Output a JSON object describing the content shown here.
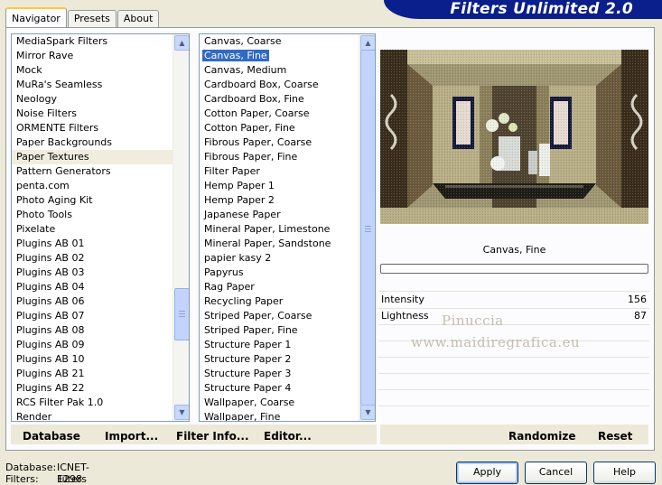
{
  "window": {
    "title": "Filters Unlimited 2.0"
  },
  "tabs": [
    {
      "label": "Navigator"
    },
    {
      "label": "Presets"
    },
    {
      "label": "About"
    }
  ],
  "categories": [
    "MediaSpark Filters",
    "Mirror Rave",
    "Mock",
    "MuRa's Seamless",
    "Neology",
    "Noise Filters",
    "ORMENTE Filters",
    "Paper Backgrounds",
    "Paper Textures",
    "Pattern Generators",
    "penta.com",
    "Photo Aging Kit",
    "Photo Tools",
    "Pixelate",
    "Plugins AB 01",
    "Plugins AB 02",
    "Plugins AB 03",
    "Plugins AB 04",
    "Plugins AB 06",
    "Plugins AB 07",
    "Plugins AB 08",
    "Plugins AB 09",
    "Plugins AB 10",
    "Plugins AB 21",
    "Plugins AB 22",
    "RCS Filter Pak 1.0",
    "Render"
  ],
  "filters": [
    "Canvas, Coarse",
    "Canvas, Fine",
    "Canvas, Medium",
    "Cardboard Box, Coarse",
    "Cardboard Box, Fine",
    "Cotton Paper, Coarse",
    "Cotton Paper, Fine",
    "Fibrous Paper, Coarse",
    "Fibrous Paper, Fine",
    "Filter Paper",
    "Hemp Paper 1",
    "Hemp Paper 2",
    "Japanese Paper",
    "Mineral Paper, Limestone",
    "Mineral Paper, Sandstone",
    "papier kasy 2",
    "Papyrus",
    "Rag Paper",
    "Recycling Paper",
    "Striped Paper, Coarse",
    "Striped Paper, Fine",
    "Structure Paper 1",
    "Structure Paper 2",
    "Structure Paper 3",
    "Structure Paper 4",
    "Wallpaper, Coarse",
    "Wallpaper, Fine"
  ],
  "selected_filter": "Canvas, Fine",
  "params": [
    {
      "name": "Intensity",
      "value": "156"
    },
    {
      "name": "Lightness",
      "value": "87"
    }
  ],
  "watermark": {
    "line1": "Pinuccia",
    "line2": "www.maidiregrafica.eu"
  },
  "links": {
    "database": "Database",
    "import": "Import...",
    "filter_info": "Filter Info...",
    "editor": "Editor...",
    "randomize": "Randomize",
    "reset": "Reset"
  },
  "status": {
    "database_label": "Database:",
    "database_value": "ICNET-Filters",
    "filters_label": "Filters:",
    "filters_value": "1298"
  },
  "buttons": {
    "apply": "Apply",
    "cancel": "Cancel",
    "help": "Help"
  }
}
